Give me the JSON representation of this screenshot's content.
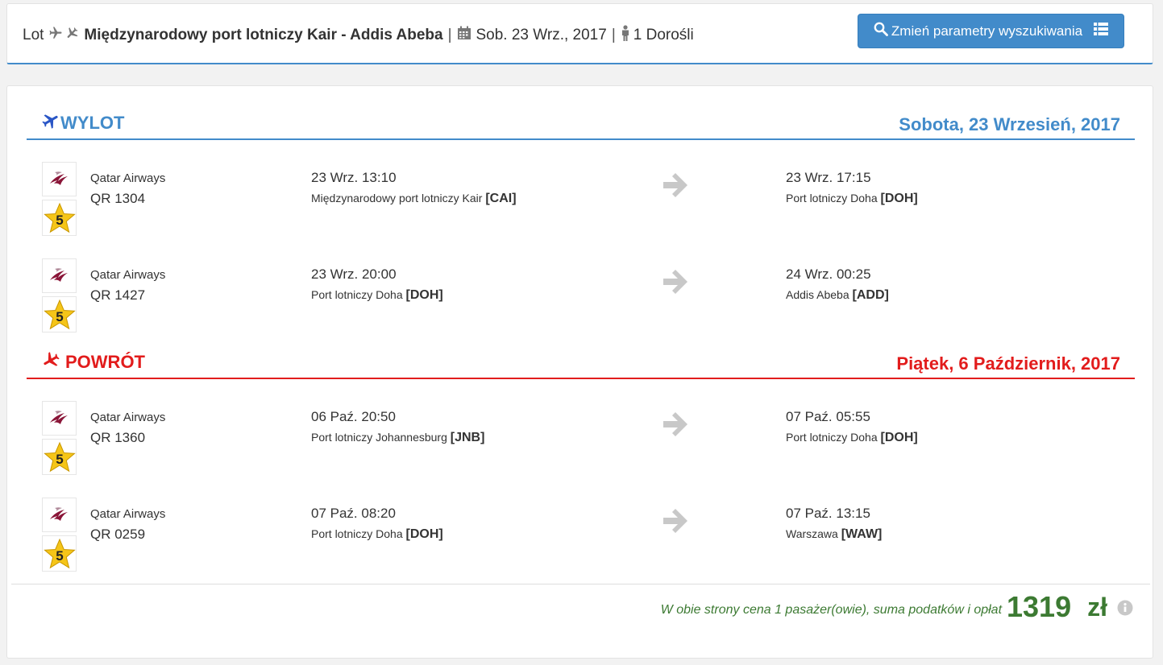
{
  "header": {
    "prefix": "Lot",
    "route": "Międzynarodowy port lotniczy Kair - Addis Abeba",
    "date": "Sob. 23 Wrz., 2017",
    "passengers": "1 Dorośli",
    "change_button": "Zmień parametry wyszukiwania"
  },
  "outbound": {
    "title": "WYLOT",
    "date": "Sobota, 23 Wrzesień, 2017",
    "segments": [
      {
        "airline": "Qatar Airways",
        "flight": "QR 1304",
        "rating": "5",
        "dep_time": "23 Wrz. 13:10",
        "dep_airport": "Międzynarodowy port lotniczy Kair",
        "dep_code": "CAI",
        "arr_time": "23 Wrz. 17:15",
        "arr_airport": "Port lotniczy Doha",
        "arr_code": "DOH"
      },
      {
        "airline": "Qatar Airways",
        "flight": "QR 1427",
        "rating": "5",
        "dep_time": "23 Wrz. 20:00",
        "dep_airport": "Port lotniczy Doha",
        "dep_code": "DOH",
        "arr_time": "24 Wrz. 00:25",
        "arr_airport": "Addis Abeba",
        "arr_code": "ADD"
      }
    ]
  },
  "return": {
    "title": "POWRÓT",
    "date": "Piątek, 6 Październik, 2017",
    "segments": [
      {
        "airline": "Qatar Airways",
        "flight": "QR 1360",
        "rating": "5",
        "dep_time": "06 Paź. 20:50",
        "dep_airport": "Port lotniczy Johannesburg",
        "dep_code": "JNB",
        "arr_time": "07 Paź. 05:55",
        "arr_airport": "Port lotniczy Doha",
        "arr_code": "DOH"
      },
      {
        "airline": "Qatar Airways",
        "flight": "QR 0259",
        "rating": "5",
        "dep_time": "07 Paź. 08:20",
        "dep_airport": "Port lotniczy Doha",
        "dep_code": "DOH",
        "arr_time": "07 Paź. 13:15",
        "arr_airport": "Warszawa",
        "arr_code": "WAW"
      }
    ]
  },
  "price": {
    "note": "W obie strony cena 1 pasażer(owie), suma podatków i opłat",
    "amount": "1319",
    "currency": "zł"
  },
  "colors": {
    "primary": "#428bca",
    "outbound": "#428bca",
    "return": "#e21c1c",
    "price": "#3c7a32",
    "arrow": "#c8c8c8"
  },
  "icons": {
    "header": [
      "plane-right-icon",
      "plane-left-icon",
      "calendar-icon",
      "person-icon",
      "search-icon",
      "list-icon"
    ],
    "sections": [
      "plane-takeoff-icon",
      "plane-landing-icon"
    ],
    "segment": [
      "qatar-airways-logo",
      "star-rating-icon",
      "arrow-right-icon"
    ],
    "price": [
      "info-icon"
    ]
  }
}
